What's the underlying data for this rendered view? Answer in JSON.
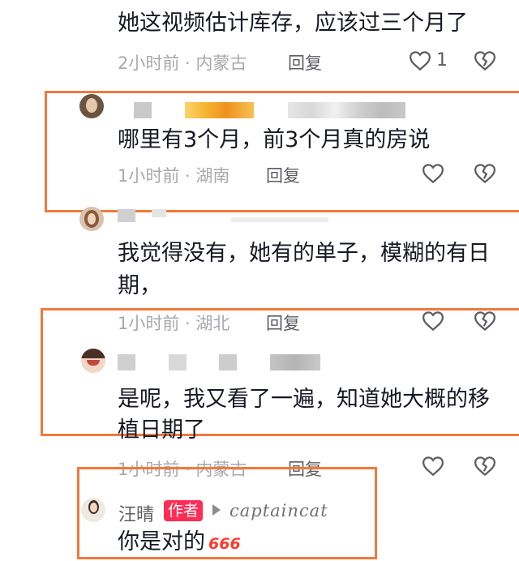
{
  "comments": [
    {
      "text": "她这视频估计库存，应该过三个月了",
      "time": "2小时前",
      "location": "内蒙古",
      "reply": "回复",
      "likes": "1"
    },
    {
      "text": "哪里有3个月，前3个月真的房说",
      "time": "1小时前",
      "location": "湖南",
      "reply": "回复"
    },
    {
      "text_line1": "我觉得没有，她有的单子，模糊的有日",
      "text_line2": "期，",
      "time": "1小时前",
      "location": "湖北",
      "reply": "回复"
    },
    {
      "text_line1": "是呢，我又看了一遍，知道她大概的移",
      "text_line2": "植日期了",
      "time": "1小时前",
      "location": "内蒙古",
      "reply": "回复"
    },
    {
      "author": "汪晴",
      "author_tag": "作者",
      "reply_to": "captaincat",
      "text": "你是对的",
      "emoji": "666"
    }
  ],
  "sep": " · ",
  "colors": {
    "highlight": "#f07a3c",
    "author_tag": "#ff2c55"
  }
}
